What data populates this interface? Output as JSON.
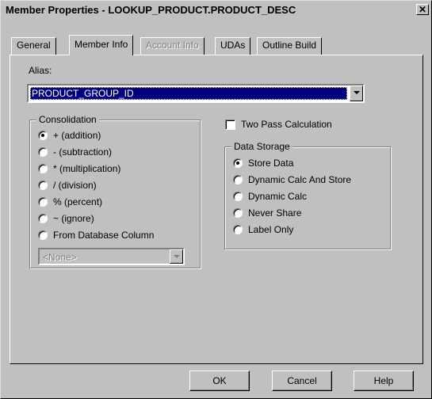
{
  "window": {
    "title": "Member Properties - LOOKUP_PRODUCT.PRODUCT_DESC",
    "close_glyph": "✕"
  },
  "tabs": [
    {
      "label": "General",
      "active": false,
      "disabled": false
    },
    {
      "label": "Member Info",
      "active": true,
      "disabled": false
    },
    {
      "label": "Account Info",
      "active": false,
      "disabled": true
    },
    {
      "label": "UDAs",
      "active": false,
      "disabled": false
    },
    {
      "label": "Outline Build",
      "active": false,
      "disabled": false
    }
  ],
  "alias": {
    "label": "Alias:",
    "value": "PRODUCT_GROUP_ID"
  },
  "consolidation": {
    "legend": "Consolidation",
    "options": [
      {
        "label": "+ (addition)",
        "checked": true
      },
      {
        "label": "- (subtraction)",
        "checked": false
      },
      {
        "label": "* (multiplication)",
        "checked": false
      },
      {
        "label": "/ (division)",
        "checked": false
      },
      {
        "label": "% (percent)",
        "checked": false
      },
      {
        "label": "~ (ignore)",
        "checked": false
      },
      {
        "label": "From Database Column",
        "checked": false
      }
    ],
    "column_value": "<None>"
  },
  "two_pass": {
    "label": "Two Pass Calculation",
    "checked": false
  },
  "data_storage": {
    "legend": "Data Storage",
    "options": [
      {
        "label": "Store Data",
        "checked": true
      },
      {
        "label": "Dynamic Calc And Store",
        "checked": false
      },
      {
        "label": "Dynamic Calc",
        "checked": false
      },
      {
        "label": "Never Share",
        "checked": false
      },
      {
        "label": "Label Only",
        "checked": false
      }
    ]
  },
  "buttons": {
    "ok": "OK",
    "cancel": "Cancel",
    "help": "Help"
  }
}
